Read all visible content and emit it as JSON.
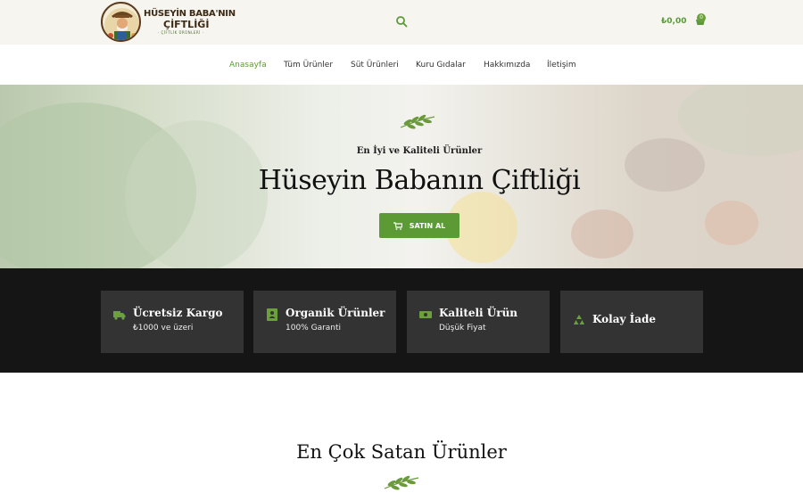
{
  "brand": {
    "line1": "HÜSEYİN BABA'NIN",
    "line2": "ÇİFTLİĞİ",
    "line3": "· ÇİFTLİK ÜRÜNLERİ ·"
  },
  "header": {
    "cart_price": "₺0,00",
    "cart_count": "0"
  },
  "nav": {
    "items": [
      {
        "label": "Anasayfa",
        "active": true
      },
      {
        "label": "Tüm Ürünler"
      },
      {
        "label": "Süt Ürünleri"
      },
      {
        "label": "Kuru Gıdalar"
      },
      {
        "label": "Hakkımızda"
      },
      {
        "label": "İletişim"
      }
    ]
  },
  "hero": {
    "subtitle": "En İyi ve Kaliteli Ürünler",
    "title": "Hüseyin Babanın Çiftliği",
    "button_label": "SATIN AL"
  },
  "features": [
    {
      "title": "Ücretsiz Kargo",
      "subtitle": "₺1000 ve üzeri",
      "icon": "truck-icon"
    },
    {
      "title": "Organik Ürünler",
      "subtitle": "100% Garanti",
      "icon": "contact-book-icon"
    },
    {
      "title": "Kaliteli Ürün",
      "subtitle": "Düşük Fiyat",
      "icon": "money-icon"
    },
    {
      "title": "Kolay İade",
      "icon": "recycle-icon"
    }
  ],
  "best_sellers": {
    "title": "En Çok Satan Ürünler"
  },
  "colors": {
    "accent": "#5c9a36",
    "dark_band": "#151515",
    "card": "#333333"
  }
}
